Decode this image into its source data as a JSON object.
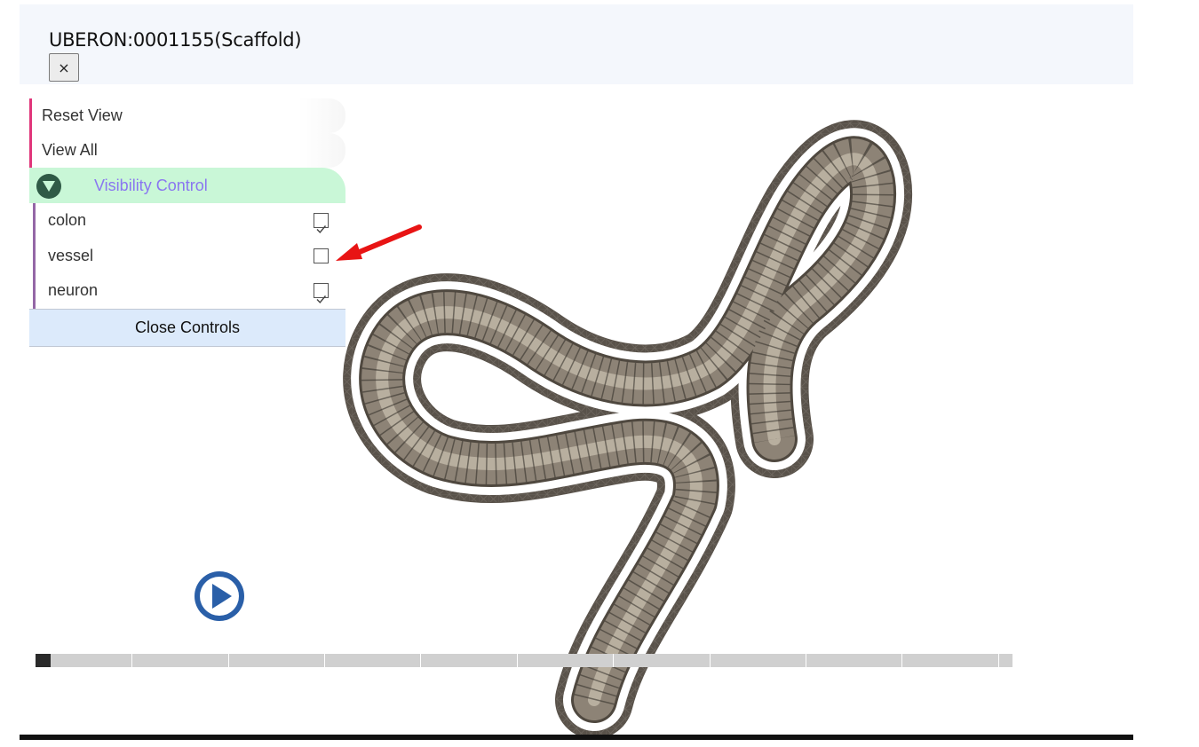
{
  "header": {
    "title": "UBERON:0001155(Scaffold)",
    "close_label": "×"
  },
  "controls": {
    "reset_view": "Reset View",
    "view_all": "View All",
    "visibility_folder": "Visibility Control",
    "items": [
      {
        "label": "colon",
        "checked": true
      },
      {
        "label": "vessel",
        "checked": false
      },
      {
        "label": "neuron",
        "checked": true
      }
    ],
    "close_controls": "Close Controls"
  },
  "player": {
    "progress": 0.015,
    "segments": 10
  },
  "colors": {
    "accent_pink": "#e0357a",
    "folder_bg": "#c9f7d7",
    "folder_text": "#8a76f0",
    "play_blue": "#2a5fa8",
    "annotation_arrow": "#e81414",
    "colon_surface": "#8d8376"
  }
}
